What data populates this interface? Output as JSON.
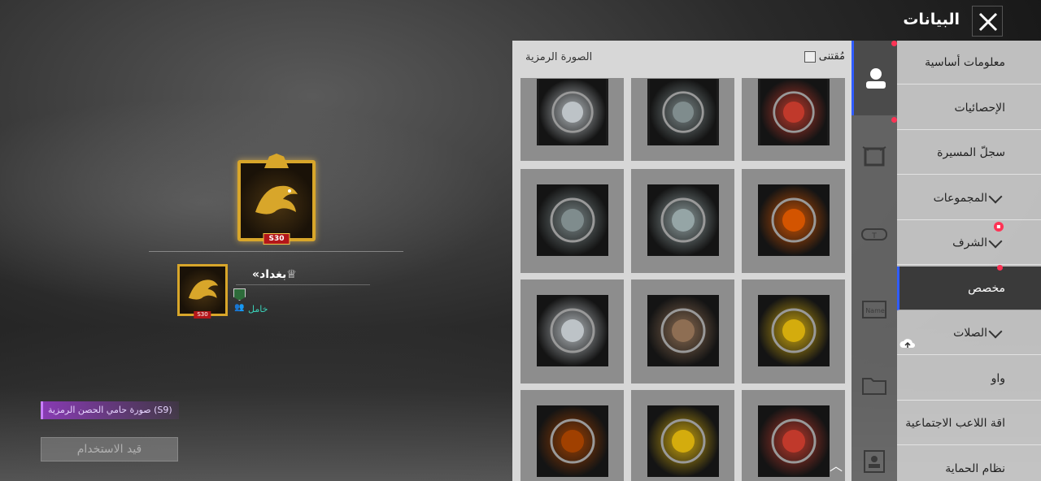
{
  "header": {
    "title": "البيانات",
    "close_icon": "close-icon"
  },
  "panel": {
    "title": "الصورة الرمزية",
    "owned_label": "مُقتنى"
  },
  "menu": {
    "items": [
      {
        "label": "معلومات أساسية",
        "chevron": false
      },
      {
        "label": "الإحصائيات",
        "chevron": false
      },
      {
        "label": "سجلّ المسيرة",
        "chevron": false
      },
      {
        "label": "المجموعات",
        "chevron": true
      },
      {
        "label": "الشرف",
        "chevron": true
      },
      {
        "label": "مخصص",
        "chevron": false,
        "active": true
      },
      {
        "label": "الصلات",
        "chevron": true
      },
      {
        "label": "واو",
        "chevron": false
      },
      {
        "label": "اقة اللاعب الاجتماعية",
        "chevron": false
      },
      {
        "label": "نظام الحماية",
        "chevron": false
      }
    ]
  },
  "icon_tabs": [
    "avatar-icon",
    "frame-icon",
    "nameplate-icon",
    "name-card-icon",
    "folder-icon",
    "player-card-icon"
  ],
  "tiles": [
    {
      "name": "rooster-emblem",
      "color": "#c0392b"
    },
    {
      "name": "squad-emblem",
      "color": "#7f8c8d"
    },
    {
      "name": "silver-star-emblem",
      "color": "#bdc3c7"
    },
    {
      "name": "gunman-silhouette",
      "color": "#d35400"
    },
    {
      "name": "duo-silhouette",
      "color": "#95a5a6"
    },
    {
      "name": "grenade-emblem",
      "color": "#7f8c8d"
    },
    {
      "name": "helmet-emblem",
      "color": "#d4ac0d"
    },
    {
      "name": "squad-soldiers",
      "color": "#8e6e53"
    },
    {
      "name": "medkit-emblem",
      "color": "#bdc3c7"
    },
    {
      "name": "umbrella-emblem",
      "color": "#c0392b"
    },
    {
      "name": "crossed-rifles-emblem",
      "color": "#d4ac0d"
    },
    {
      "name": "100-victory-emblem",
      "color": "#a04000"
    }
  ],
  "preview": {
    "season_badge": "S30",
    "player_name": "«بغداد♕",
    "status": "خامل",
    "avatar_caption": "صورة حامي الحصن الرمزية (S9)",
    "use_button_label": "قيد الاستخدام"
  },
  "colors": {
    "accent_blue": "#2f5cff",
    "notify_red": "#ff3355",
    "gold": "#d8a62a",
    "status_teal": "#3ad1b8"
  }
}
